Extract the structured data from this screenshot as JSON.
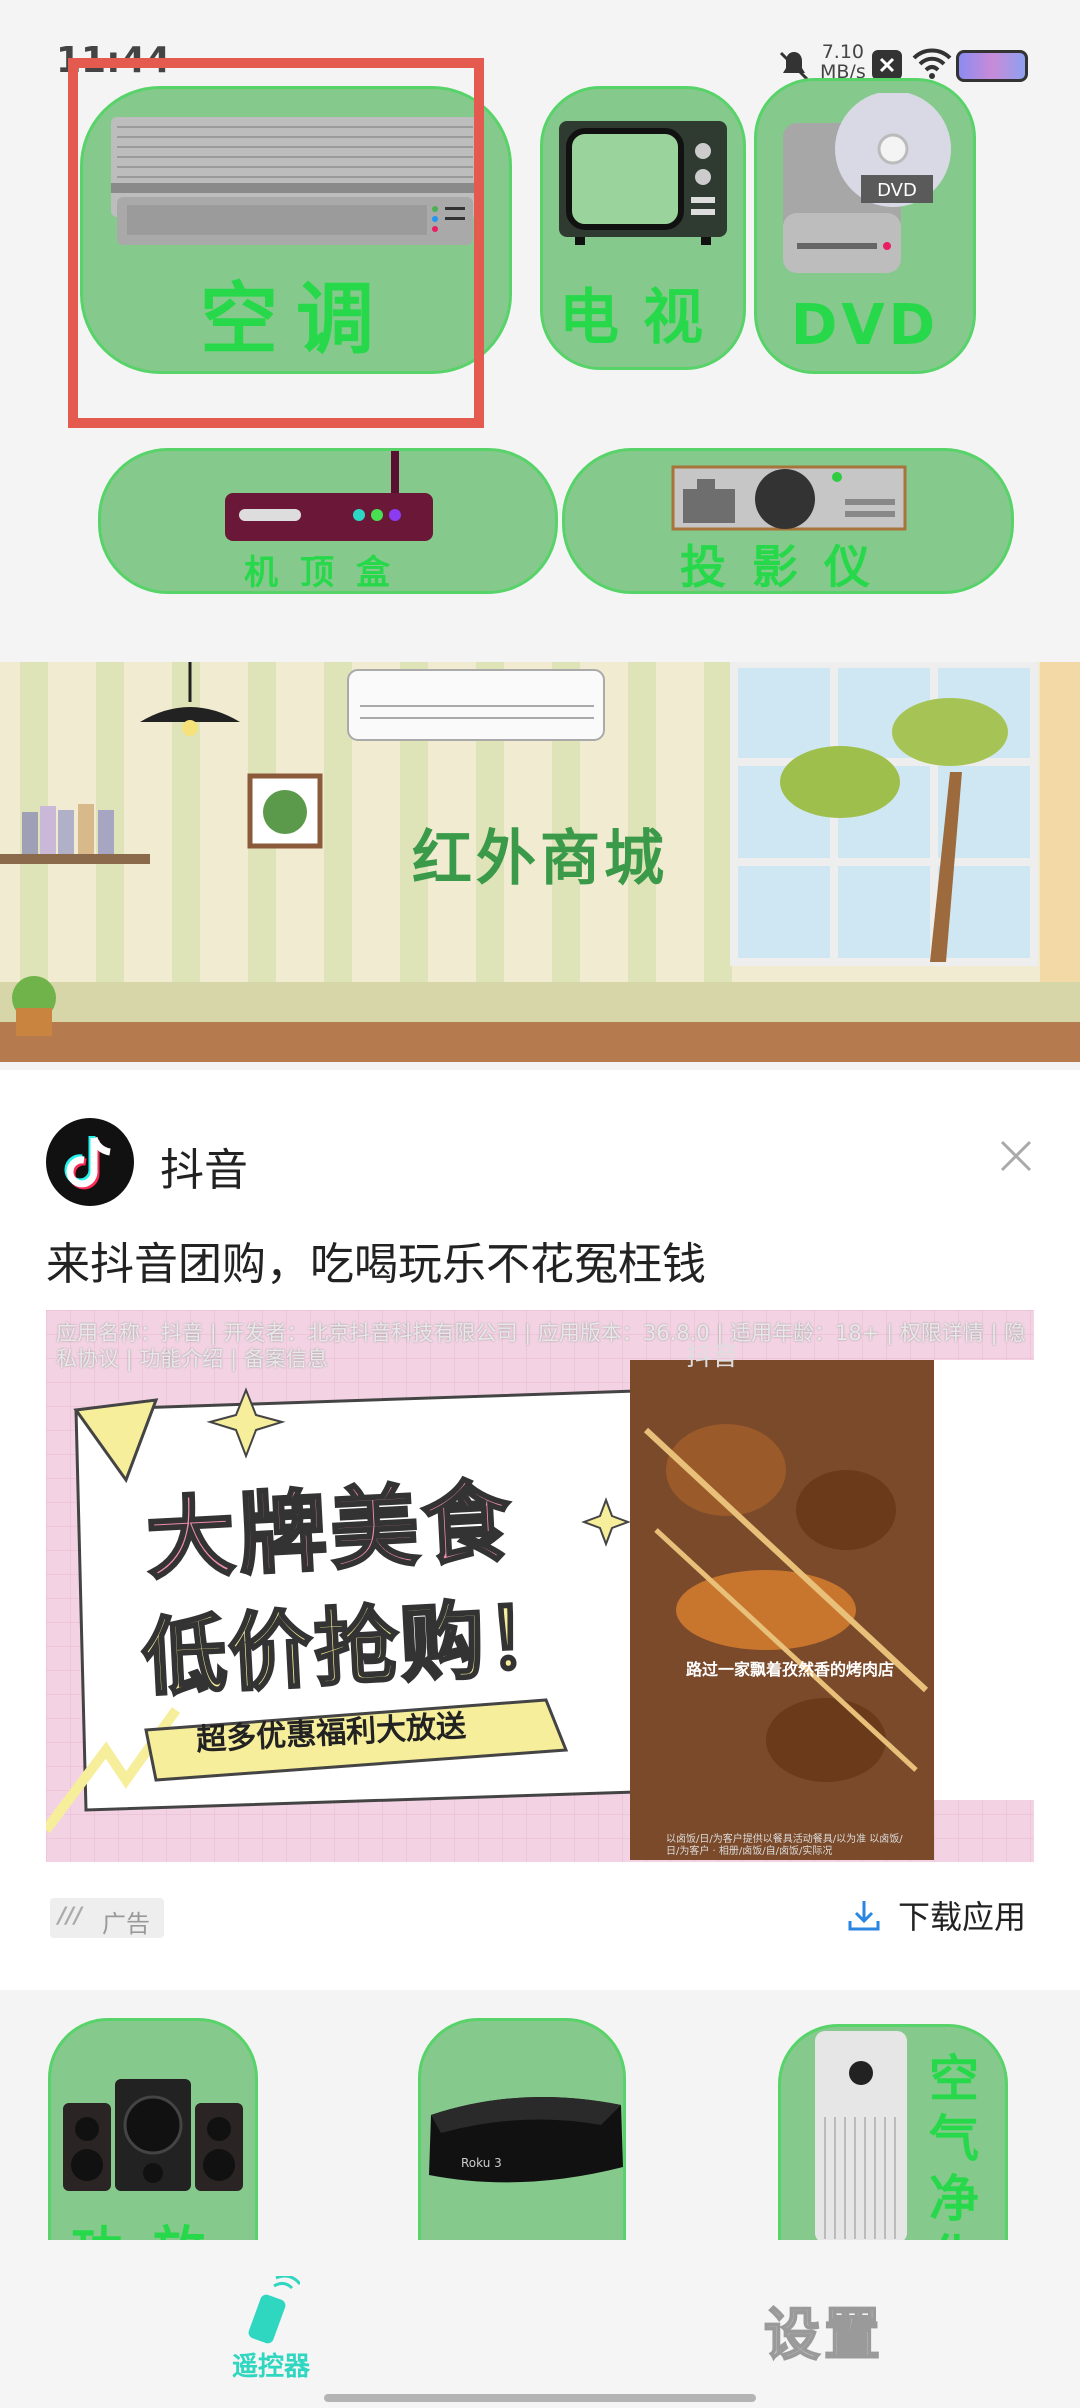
{
  "status_bar": {
    "time": "11:44",
    "net_speed_value": "7.10",
    "net_speed_unit": "MB/s"
  },
  "devices": {
    "ac": {
      "label": "空调"
    },
    "tv": {
      "label": "电视"
    },
    "dvd": {
      "label": "DVD",
      "disc_label": "DVD"
    },
    "stb": {
      "label": "机顶盒"
    },
    "projector": {
      "label": "投影仪"
    }
  },
  "banner": {
    "title": "红外商城"
  },
  "ad": {
    "app_name": "抖音",
    "headline": "来抖音团购，吃喝玩乐不花冤枉钱",
    "info_line": "应用名称：抖音 | 开发者：北京抖音科技有限公司 | 应用版本：36.8.0 | 适用年龄：18+ | 权限详情 | 隐私协议 | 功能介绍 | 备案信息",
    "watermark": "抖音",
    "promo_line1": "大牌美食",
    "promo_line2": "低价抢购！",
    "promo_ribbon": "超多优惠福利大放送",
    "photo_caption": "路过一家飘着孜然香的烤肉店",
    "photo_small_text": "以卤饭/日/为客户提供以餐具活动餐具/以为准 以卤饭/日/为客户 · 相册/卤饭/自/卤饭/实际况",
    "badge": "广告",
    "download_label": "下载应用"
  },
  "bottom_devices": {
    "amp": {
      "label": "功放"
    },
    "box": {
      "brand": "Roku 3"
    },
    "air_purifier": {
      "label": "空气净化"
    }
  },
  "nav": {
    "remote_label": "遥控器",
    "settings_label": "设置"
  },
  "colors": {
    "tile_green": "#86c98c",
    "label_green": "#27d94a",
    "selection_red": "#e45a4f",
    "download_blue": "#2a86e0"
  }
}
